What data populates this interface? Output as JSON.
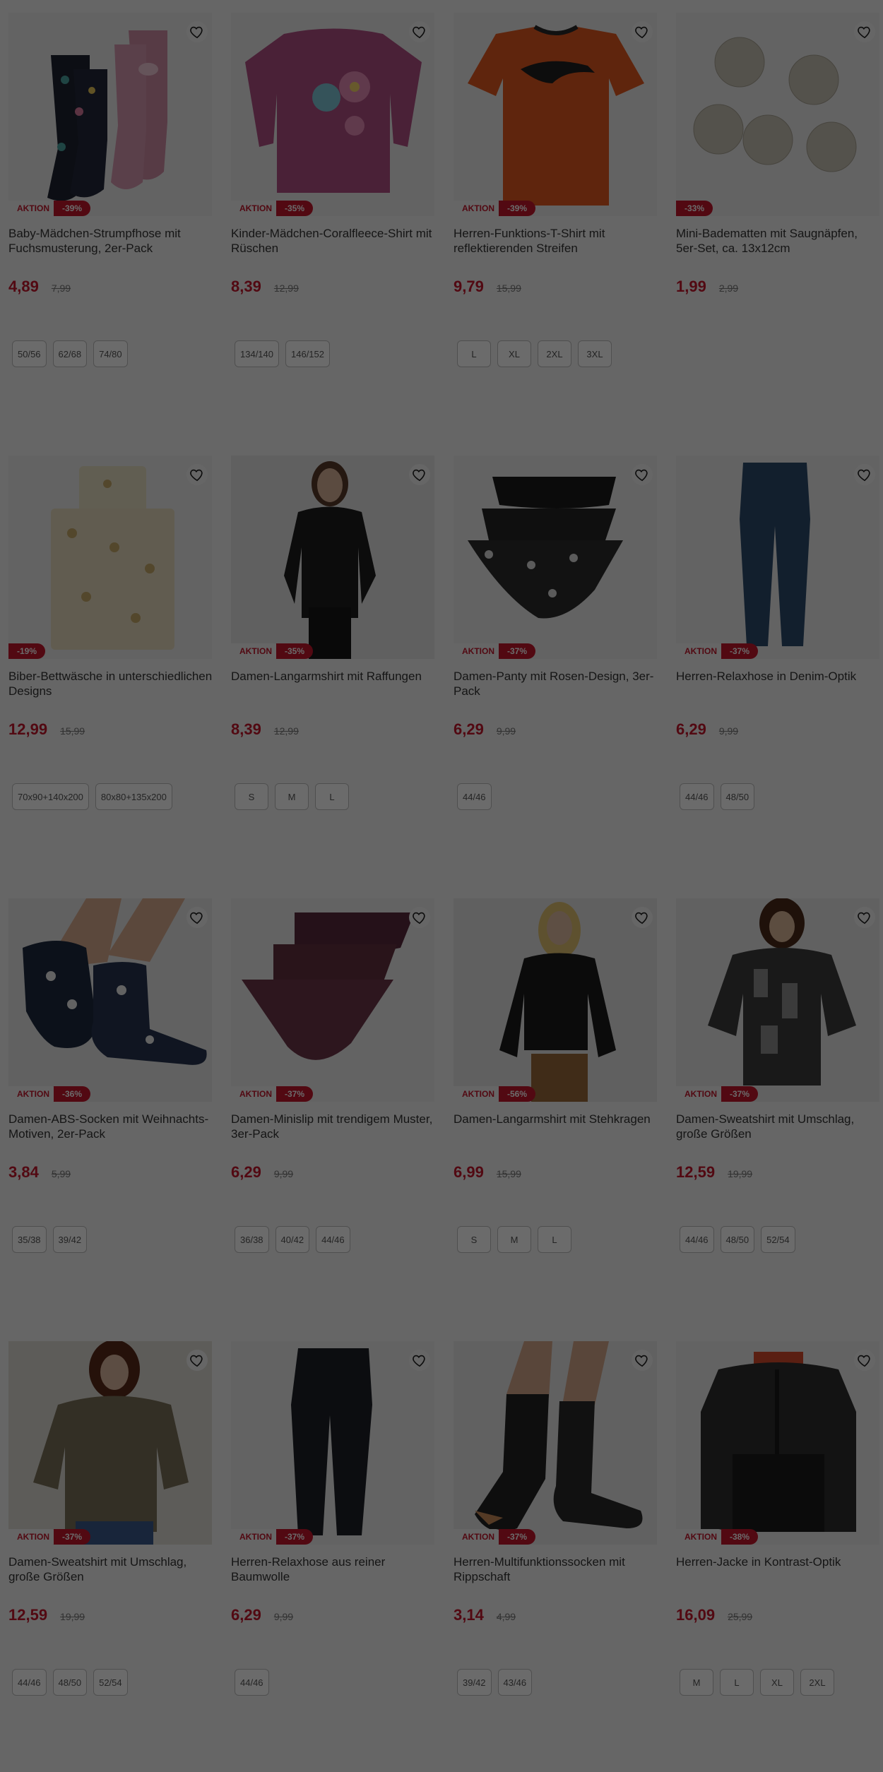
{
  "labels": {
    "aktion": "AKTION"
  },
  "colors": {
    "accent": "#c3162c",
    "overlay": "rgba(0,0,0,0.58)"
  },
  "products": [
    {
      "title": "Baby-Mädchen-Strumpfhose mit Fuchsmusterung, 2er-Pack",
      "price": "4,89",
      "old_price": "7,99",
      "discount": "-39%",
      "aktion": true,
      "sizes": [
        "50/56",
        "62/68",
        "74/80"
      ],
      "image": "tights-image"
    },
    {
      "title": "Kinder-Mädchen-Coralfleece-Shirt mit Rüschen",
      "price": "8,39",
      "old_price": "12,99",
      "discount": "-35%",
      "aktion": true,
      "sizes": [
        "134/140",
        "146/152"
      ],
      "image": "pink-sweater-image"
    },
    {
      "title": "Herren-Funktions-T-Shirt mit reflektierenden Streifen",
      "price": "9,79",
      "old_price": "15,99",
      "discount": "-39%",
      "aktion": true,
      "sizes": [
        "L",
        "XL",
        "2XL",
        "3XL"
      ],
      "image": "orange-tshirt-image"
    },
    {
      "title": "Mini-Badematten mit Saugnäpfen, 5er-Set, ca. 13x12cm",
      "price": "1,99",
      "old_price": "2,99",
      "discount": "-33%",
      "aktion": false,
      "sizes": [],
      "image": "bath-mats-image"
    },
    {
      "title": "Biber-Bettwäsche in unterschiedlichen Designs",
      "price": "12,99",
      "old_price": "15,99",
      "discount": "-19%",
      "aktion": false,
      "sizes": [
        "70x90+140x200",
        "80x80+135x200"
      ],
      "image": "bedding-image"
    },
    {
      "title": "Damen-Langarmshirt mit Raffungen",
      "price": "8,39",
      "old_price": "12,99",
      "discount": "-35%",
      "aktion": true,
      "sizes": [
        "S",
        "M",
        "L"
      ],
      "image": "woman-black-shirt-image"
    },
    {
      "title": "Damen-Panty mit Rosen-Design, 3er-Pack",
      "price": "6,29",
      "old_price": "9,99",
      "discount": "-37%",
      "aktion": true,
      "sizes": [
        "44/46"
      ],
      "image": "panties-image"
    },
    {
      "title": "Herren-Relaxhose in Denim-Optik",
      "price": "6,29",
      "old_price": "9,99",
      "discount": "-37%",
      "aktion": true,
      "sizes": [
        "44/46",
        "48/50"
      ],
      "image": "blue-pants-image"
    },
    {
      "title": "Damen-ABS-Socken mit Weihnachts-Motiven, 2er-Pack",
      "price": "3,84",
      "old_price": "5,99",
      "discount": "-36%",
      "aktion": true,
      "sizes": [
        "35/38",
        "39/42"
      ],
      "image": "christmas-socks-image"
    },
    {
      "title": "Damen-Minislip mit trendigem Muster, 3er-Pack",
      "price": "6,29",
      "old_price": "9,99",
      "discount": "-37%",
      "aktion": true,
      "sizes": [
        "36/38",
        "40/42",
        "44/46"
      ],
      "image": "minislip-image"
    },
    {
      "title": "Damen-Langarmshirt mit Stehkragen",
      "price": "6,99",
      "old_price": "15,99",
      "discount": "-56%",
      "aktion": true,
      "sizes": [
        "S",
        "M",
        "L"
      ],
      "image": "woman-blonde-shirt-image"
    },
    {
      "title": "Damen-Sweatshirt mit Umschlag, große Größen",
      "price": "12,59",
      "old_price": "19,99",
      "discount": "-37%",
      "aktion": true,
      "sizes": [
        "44/46",
        "48/50",
        "52/54"
      ],
      "image": "patterned-sweatshirt-image"
    },
    {
      "title": "Damen-Sweatshirt mit Umschlag, große Größen",
      "price": "12,59",
      "old_price": "19,99",
      "discount": "-37%",
      "aktion": true,
      "sizes": [
        "44/46",
        "48/50",
        "52/54"
      ],
      "image": "olive-sweatshirt-image"
    },
    {
      "title": "Herren-Relaxhose aus reiner Baumwolle",
      "price": "6,29",
      "old_price": "9,99",
      "discount": "-37%",
      "aktion": true,
      "sizes": [
        "44/46"
      ],
      "image": "black-pants-image"
    },
    {
      "title": "Herren-Multifunktionssocken mit Rippschaft",
      "price": "3,14",
      "old_price": "4,99",
      "discount": "-37%",
      "aktion": true,
      "sizes": [
        "39/42",
        "43/46"
      ],
      "image": "black-socks-image"
    },
    {
      "title": "Herren-Jacke in Kontrast-Optik",
      "price": "16,09",
      "old_price": "25,99",
      "discount": "-38%",
      "aktion": true,
      "sizes": [
        "M",
        "L",
        "XL",
        "2XL"
      ],
      "image": "jacket-image"
    }
  ]
}
